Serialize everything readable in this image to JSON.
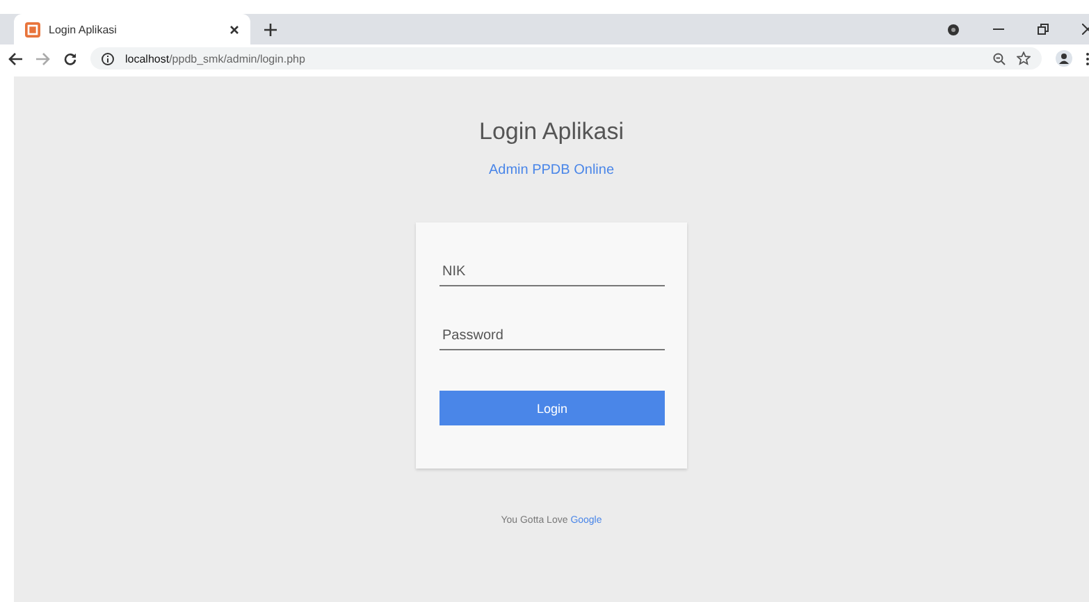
{
  "browser": {
    "tab": {
      "title": "Login Aplikasi",
      "selected": true
    },
    "url": {
      "host": "localhost",
      "path": "/ppdb_smk/admin/login.php"
    }
  },
  "page": {
    "title": "Login Aplikasi",
    "subtitle": "Admin PPDB Online",
    "fields": [
      {
        "placeholder": "NIK"
      },
      {
        "placeholder": "Password"
      }
    ],
    "button": "Login",
    "footer": {
      "text": "You Gotta Love",
      "link": "Google"
    }
  }
}
